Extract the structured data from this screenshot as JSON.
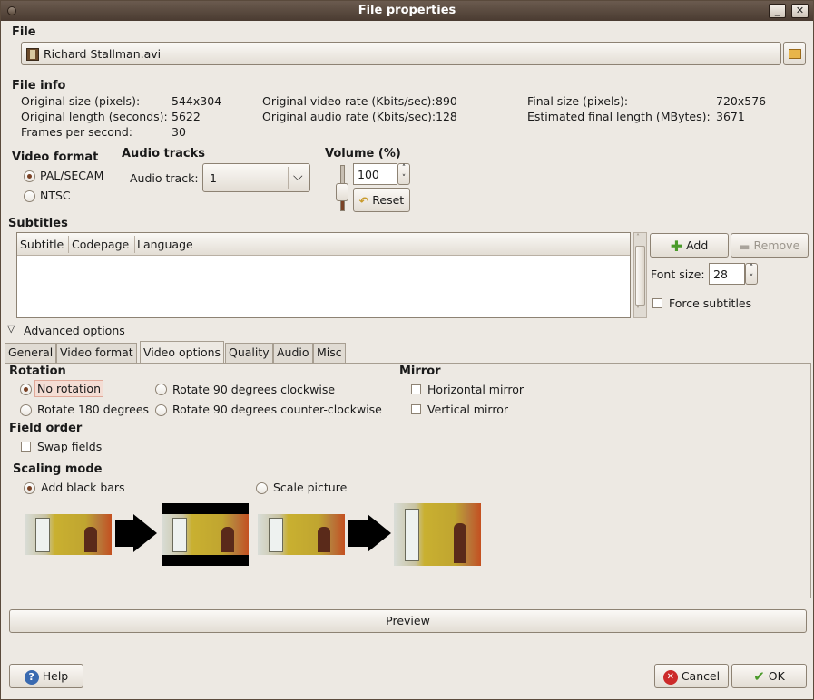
{
  "window": {
    "title": "File properties"
  },
  "file": {
    "section_label": "File",
    "filename": "Richard Stallman.avi"
  },
  "fileinfo": {
    "label": "File info",
    "original_size_label": "Original size (pixels):",
    "original_size_value": "544x304",
    "original_length_label": "Original length (seconds):",
    "original_length_value": "5622",
    "fps_label": "Frames per second:",
    "fps_value": "30",
    "video_rate_label": "Original video rate (Kbits/sec):",
    "video_rate_value": "890",
    "audio_rate_label": "Original audio rate (Kbits/sec):",
    "audio_rate_value": "128",
    "final_size_label": "Final size (pixels):",
    "final_size_value": "720x576",
    "final_length_label": "Estimated final length (MBytes):",
    "final_length_value": "3671"
  },
  "video_format": {
    "label": "Video format",
    "pal": "PAL/SECAM",
    "ntsc": "NTSC"
  },
  "audio_tracks": {
    "label": "Audio tracks",
    "track_label": "Audio track:",
    "track_value": "1"
  },
  "volume": {
    "label": "Volume (%)",
    "value": "100",
    "reset": "Reset"
  },
  "subtitles": {
    "label": "Subtitles",
    "columns": [
      "Subtitle",
      "Codepage",
      "Language"
    ],
    "add": "Add",
    "remove": "Remove",
    "font_size_label": "Font size:",
    "font_size_value": "28",
    "force": "Force subtitles"
  },
  "advanced": {
    "label": "Advanced options"
  },
  "tabs": [
    "General",
    "Video format",
    "Video options",
    "Quality",
    "Audio",
    "Misc"
  ],
  "video_options": {
    "rotation_label": "Rotation",
    "no_rotation": "No rotation",
    "rotate_180": "Rotate 180 degrees",
    "rotate_cw": "Rotate 90 degrees clockwise",
    "rotate_ccw": "Rotate 90 degrees counter-clockwise",
    "mirror_label": "Mirror",
    "horizontal_mirror": "Horizontal mirror",
    "vertical_mirror": "Vertical mirror",
    "field_order_label": "Field order",
    "swap_fields": "Swap fields",
    "scaling_label": "Scaling mode",
    "black_bars": "Add black bars",
    "scale_picture": "Scale picture"
  },
  "buttons": {
    "preview": "Preview",
    "help": "Help",
    "cancel": "Cancel",
    "ok": "OK"
  },
  "colors": {
    "accent": "#7a4226",
    "titlebar": "#5a4a3c"
  }
}
